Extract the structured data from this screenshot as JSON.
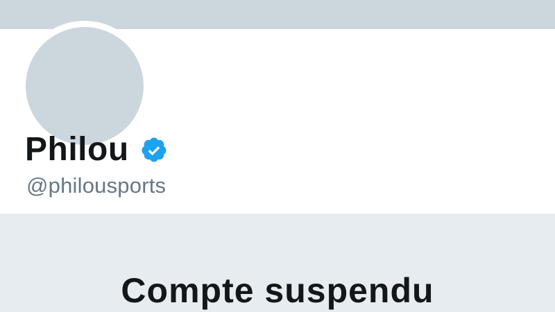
{
  "profile": {
    "display_name": "Philou",
    "handle": "@philousports",
    "verified": true
  },
  "status": {
    "title": "Compte suspendu"
  },
  "colors": {
    "banner": "#ccd6dd",
    "avatar_placeholder": "#ccd6dd",
    "verified_badge": "#1da1f2",
    "handle_text": "#657786",
    "suspended_background": "#e6ecf0",
    "primary_text": "#14171a"
  },
  "icons": {
    "verified": "verified-badge-icon"
  }
}
